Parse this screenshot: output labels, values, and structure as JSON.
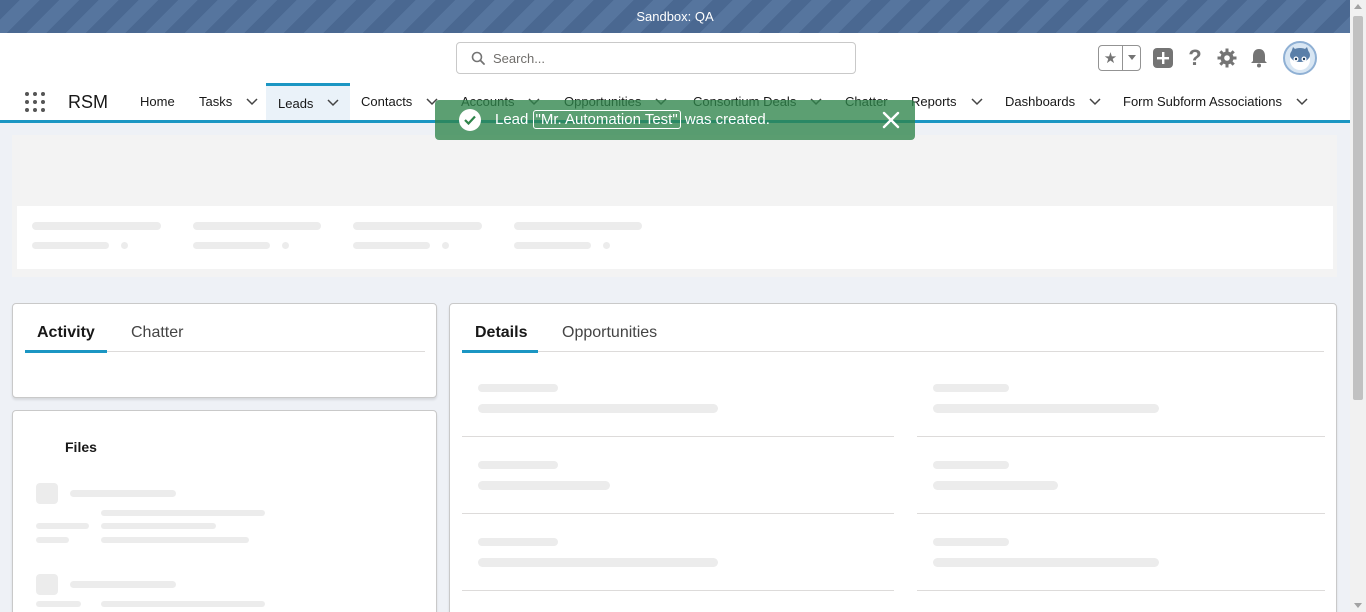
{
  "sandbox_banner": "Sandbox: QA",
  "search": {
    "placeholder": "Search..."
  },
  "header_icons": [
    "favorites-star-icon",
    "add-icon",
    "help-icon",
    "setup-gear-icon",
    "notifications-bell-icon"
  ],
  "app_name": "RSM",
  "nav": {
    "items": [
      {
        "label": "Home",
        "has_menu": false
      },
      {
        "label": "Tasks",
        "has_menu": true
      },
      {
        "label": "Leads",
        "has_menu": true,
        "active": true
      },
      {
        "label": "Contacts",
        "has_menu": true
      },
      {
        "label": "Accounts",
        "has_menu": true
      },
      {
        "label": "Opportunities",
        "has_menu": true
      },
      {
        "label": "Consortium Deals",
        "has_menu": true
      },
      {
        "label": "Chatter",
        "has_menu": false
      },
      {
        "label": "Reports",
        "has_menu": true
      },
      {
        "label": "Dashboards",
        "has_menu": true
      },
      {
        "label": "Form Subform Associations",
        "has_menu": true
      }
    ]
  },
  "toast": {
    "prefix": "Lead ",
    "link": "\"Mr. Automation Test\"",
    "suffix": " was created.",
    "color": "#2e844a"
  },
  "left_tabs": [
    {
      "label": "Activity",
      "active": true
    },
    {
      "label": "Chatter",
      "active": false
    }
  ],
  "files": {
    "title": "Files"
  },
  "right_tabs": [
    {
      "label": "Details",
      "active": true
    },
    {
      "label": "Opportunities",
      "active": false
    }
  ],
  "colors": {
    "accent": "#1b96c3",
    "sandbox": "#4a6891"
  }
}
